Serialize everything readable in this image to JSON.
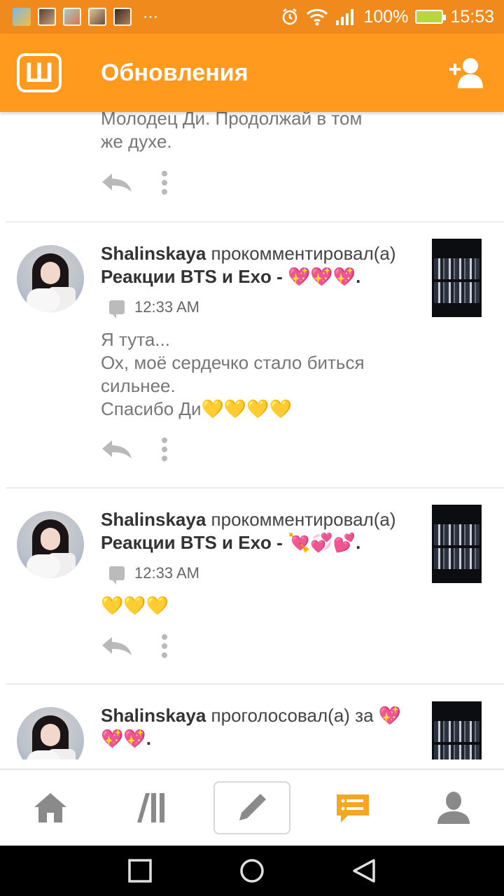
{
  "status_bar": {
    "battery": "100%",
    "time": "15:53",
    "overflow": "⋯"
  },
  "app_bar": {
    "logo_letter": "Ш",
    "title": "Обновления",
    "add_friend_icon": "add-user-icon"
  },
  "feed": {
    "partial_message": {
      "line1": "Молодец Ди. Продолжай в том",
      "line2": "же духе."
    },
    "posts": [
      {
        "username": "Shalinskaya",
        "verb": "прокомментировал(а)",
        "story": "Реакции BTS и Exo - 💖💖💖.",
        "time": "12:33 AM",
        "message_lines": [
          "Я тута...",
          "Ох, моё сердечко стало биться",
          "сильнее.",
          "Спасибо Ди💛💛💛💛"
        ]
      },
      {
        "username": "Shalinskaya",
        "verb": "прокомментировал(а)",
        "story": "Реакции BTS и Exo - 💘💞💕.",
        "time": "12:33 AM",
        "message_lines": [
          "💛💛💛"
        ]
      },
      {
        "username": "Shalinskaya",
        "verb": "проголосовал(а) за 💖",
        "story_line2": "💖💖."
      }
    ]
  },
  "bottom_nav": {
    "items": [
      "home-icon",
      "library-icon",
      "compose-icon",
      "messages-icon",
      "profile-icon"
    ],
    "active": "messages-icon",
    "accent": "#f5a623"
  },
  "colors": {
    "status_bar": "#f08a1c",
    "app_bar": "#ff9a1f",
    "text_muted": "#777777"
  }
}
